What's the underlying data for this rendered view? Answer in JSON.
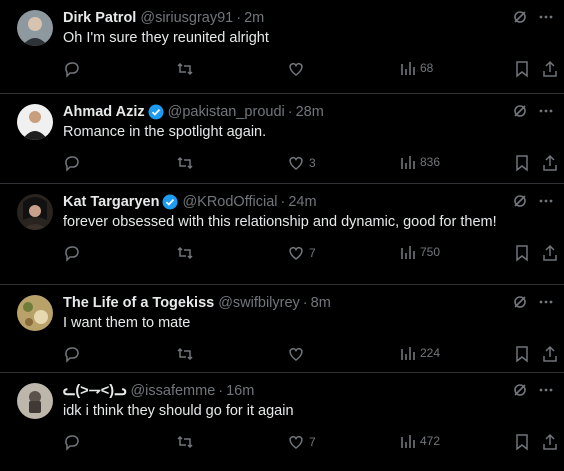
{
  "tweets": [
    {
      "name": "Dirk Patrol",
      "verified": false,
      "handle": "@siriusgray91",
      "time": "2m",
      "text": "Oh I'm sure they reunited alright",
      "replies": "",
      "retweets": "",
      "likes": "",
      "views": "68",
      "avatar_colors": [
        "#9aa4ad",
        "#3b3f44"
      ]
    },
    {
      "name": "Ahmad Aziz",
      "verified": true,
      "handle": "@pakistan_proudi",
      "time": "28m",
      "text": "Romance in the spotlight again.",
      "replies": "",
      "retweets": "",
      "likes": "3",
      "views": "836",
      "avatar_colors": [
        "#e8e8e8",
        "#2b2b2b"
      ]
    },
    {
      "name": "Kat Targaryen",
      "verified": true,
      "handle": "@KRodOfficial",
      "time": "24m",
      "text": "forever obsessed with this relationship and dynamic, good for them!",
      "replies": "",
      "retweets": "",
      "likes": "7",
      "views": "750",
      "avatar_colors": [
        "#5a4a44",
        "#1a1a1a"
      ]
    },
    {
      "name": "The Life of a Togekiss",
      "verified": false,
      "handle": "@swifbilyrey",
      "time": "8m",
      "text": "I want them to mate",
      "replies": "",
      "retweets": "",
      "likes": "",
      "views": "224",
      "avatar_colors": [
        "#c9b27a",
        "#6e7a3c"
      ]
    },
    {
      "name": "ᓚ(>⇁<)ᓗ",
      "verified": false,
      "handle": "@issafemme",
      "time": "16m",
      "text": "idk i think they should go for it again",
      "replies": "",
      "retweets": "",
      "likes": "7",
      "views": "472",
      "avatar_colors": [
        "#b8b2a8",
        "#4a4540"
      ]
    }
  ],
  "colors": {
    "background": "#000000",
    "text": "#e7e9ea",
    "muted": "#71767b",
    "verified": "#1d9bf0",
    "divider": "#2f3336"
  },
  "icons": [
    "reply-icon",
    "retweet-icon",
    "like-icon",
    "views-icon",
    "bookmark-icon",
    "share-icon",
    "grok-icon",
    "more-icon",
    "verified-badge-icon"
  ]
}
